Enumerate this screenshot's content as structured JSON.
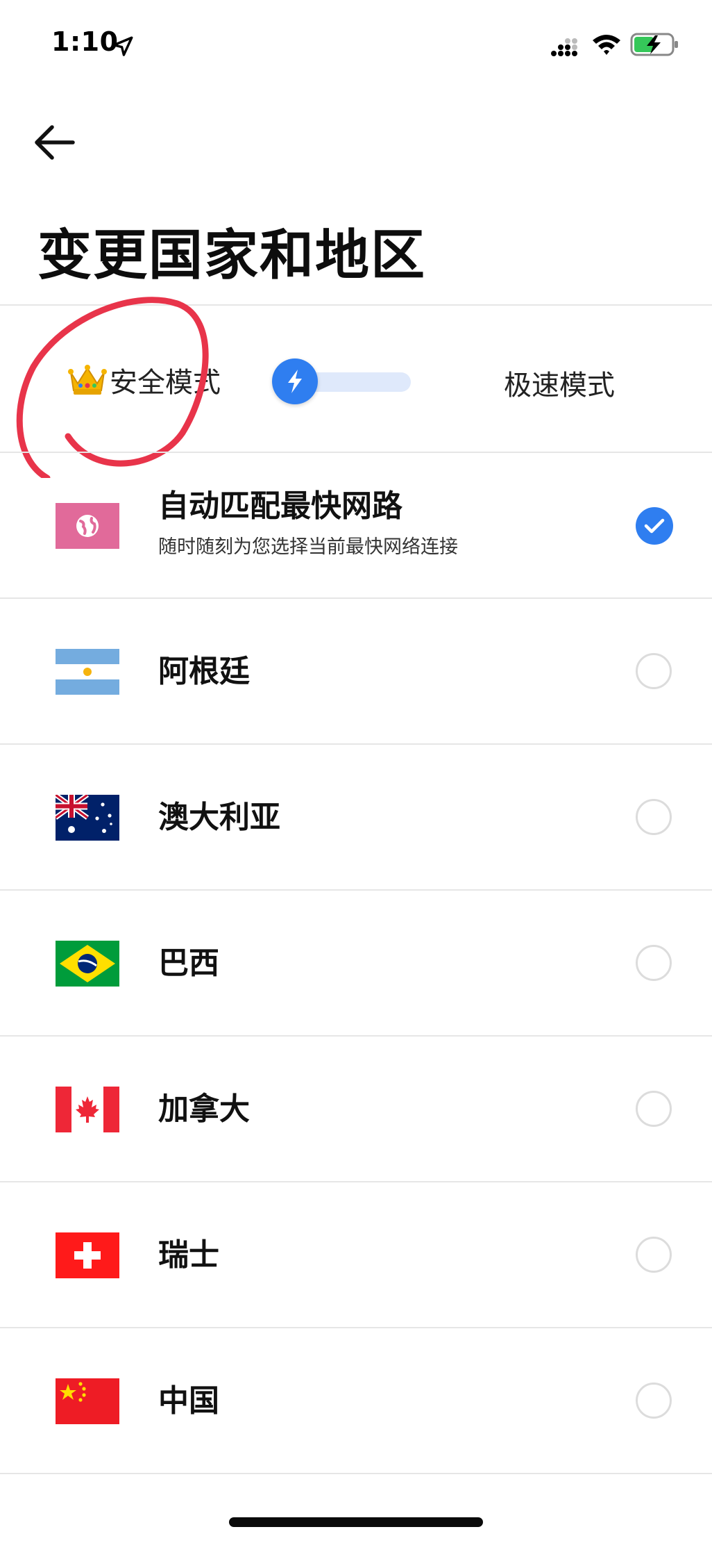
{
  "status_bar": {
    "time": "1:10",
    "icons": [
      "location-arrow-icon",
      "cellular-signal-icon",
      "wifi-icon",
      "battery-charging-icon"
    ]
  },
  "header": {
    "back_icon": "arrow-left-icon",
    "title": "变更国家和地区"
  },
  "mode_switch": {
    "safe_label": "安全模式",
    "safe_icon": "crown-icon",
    "fast_label": "极速模式",
    "toggle_icon": "lightning-bolt-icon",
    "active": "安全模式"
  },
  "colors": {
    "accent": "#2f7ef0",
    "track": "#dfe9fb",
    "divider": "#e6e6e6",
    "annotation": "#e8344a"
  },
  "regions": [
    {
      "label": "自动匹配最快网路",
      "subtitle": "随时随刻为您选择当前最快网络连接",
      "flag_icon": "globe-icon",
      "selected": true
    },
    {
      "label": "阿根廷",
      "flag_icon": "argentina-flag-icon",
      "selected": false
    },
    {
      "label": "澳大利亚",
      "flag_icon": "australia-flag-icon",
      "selected": false
    },
    {
      "label": "巴西",
      "flag_icon": "brazil-flag-icon",
      "selected": false
    },
    {
      "label": "加拿大",
      "flag_icon": "canada-flag-icon",
      "selected": false
    },
    {
      "label": "瑞士",
      "flag_icon": "switzerland-flag-icon",
      "selected": false
    },
    {
      "label": "中国",
      "flag_icon": "china-flag-icon",
      "selected": false
    }
  ]
}
